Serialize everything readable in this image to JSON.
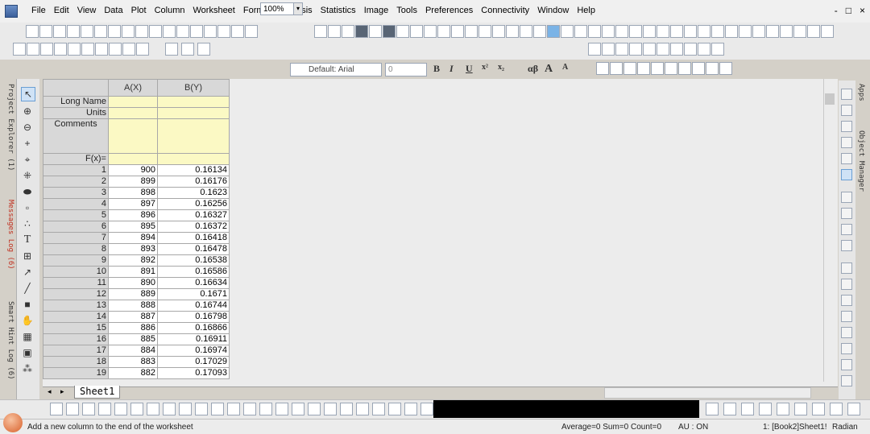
{
  "menu": [
    "File",
    "Edit",
    "View",
    "Data",
    "Plot",
    "Column",
    "Worksheet",
    "Format",
    "Analysis",
    "Statistics",
    "Image",
    "Tools",
    "Preferences",
    "Connectivity",
    "Window",
    "Help"
  ],
  "window_controls": [
    "-",
    "□",
    "×"
  ],
  "toolbar": {
    "zoom": "100%"
  },
  "format_toolbar": {
    "font": "Default: Arial",
    "size": "0",
    "bold": "B",
    "italic": "I",
    "underline": "U",
    "superscript": "x²",
    "subscript": "x₂",
    "greek": "αβ",
    "grow": "A",
    "shrink": "A"
  },
  "left_dock": {
    "project_explorer": "Project Explorer (1)",
    "messages_log": "Messages Log (6)",
    "smart_hint_log": "Smart Hint Log (6)"
  },
  "right_dock": {
    "apps": "Apps",
    "object_manager": "Object Manager"
  },
  "worksheet": {
    "columns": [
      "A(X)",
      "B(Y)"
    ],
    "meta_rows": [
      "Long Name",
      "Units",
      "Comments",
      "F(x)="
    ],
    "rows": [
      {
        "n": "1",
        "a": "900",
        "b": "0.16134"
      },
      {
        "n": "2",
        "a": "899",
        "b": "0.16176"
      },
      {
        "n": "3",
        "a": "898",
        "b": "0.1623"
      },
      {
        "n": "4",
        "a": "897",
        "b": "0.16256"
      },
      {
        "n": "5",
        "a": "896",
        "b": "0.16327"
      },
      {
        "n": "6",
        "a": "895",
        "b": "0.16372"
      },
      {
        "n": "7",
        "a": "894",
        "b": "0.16418"
      },
      {
        "n": "8",
        "a": "893",
        "b": "0.16478"
      },
      {
        "n": "9",
        "a": "892",
        "b": "0.16538"
      },
      {
        "n": "10",
        "a": "891",
        "b": "0.16586"
      },
      {
        "n": "11",
        "a": "890",
        "b": "0.16634"
      },
      {
        "n": "12",
        "a": "889",
        "b": "0.1671"
      },
      {
        "n": "13",
        "a": "888",
        "b": "0.16744"
      },
      {
        "n": "14",
        "a": "887",
        "b": "0.16798"
      },
      {
        "n": "15",
        "a": "886",
        "b": "0.16866"
      },
      {
        "n": "16",
        "a": "885",
        "b": "0.16911"
      },
      {
        "n": "17",
        "a": "884",
        "b": "0.16974"
      },
      {
        "n": "18",
        "a": "883",
        "b": "0.17029"
      },
      {
        "n": "19",
        "a": "882",
        "b": "0.17093"
      }
    ],
    "sheet_tab": "Sheet1"
  },
  "status": {
    "hint": "Add a new column to the end of the worksheet",
    "stats": "Average=0 Sum=0 Count=0",
    "au": "AU : ON",
    "active": "1: [Book2]Sheet1!",
    "angle": "Radian"
  }
}
